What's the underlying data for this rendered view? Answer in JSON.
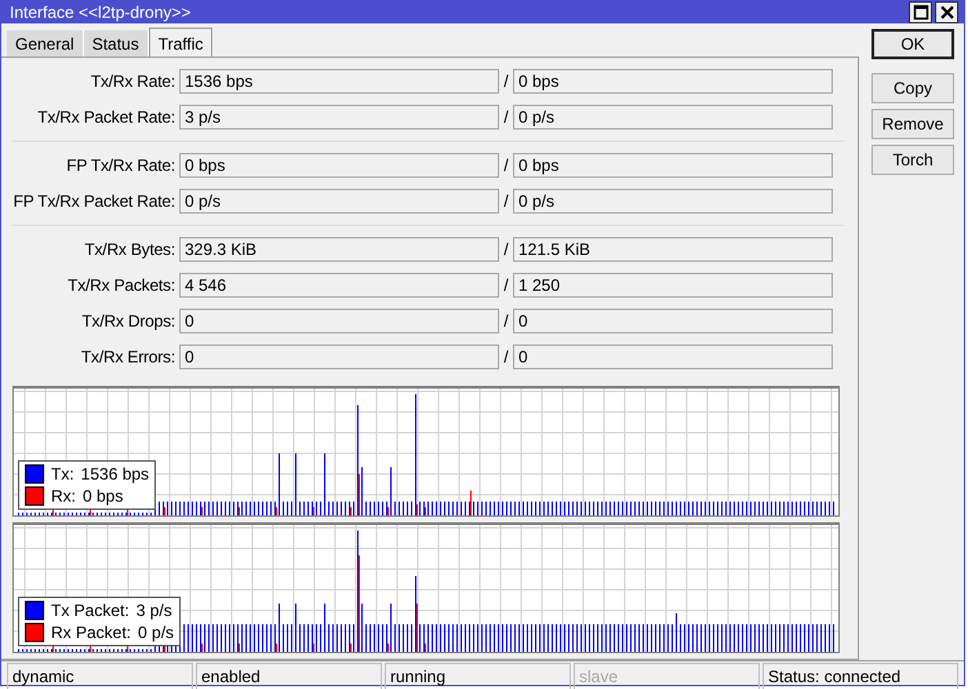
{
  "window": {
    "title": "Interface <<l2tp-drony>>"
  },
  "tabs": [
    {
      "label": "General",
      "selected": false
    },
    {
      "label": "Status",
      "selected": false
    },
    {
      "label": "Traffic",
      "selected": true
    }
  ],
  "groups": [
    {
      "rows": [
        {
          "label": "Tx/Rx Rate:",
          "tx": "1536 bps",
          "sep": "/",
          "rx": "0 bps"
        },
        {
          "label": "Tx/Rx Packet Rate:",
          "tx": "3 p/s",
          "sep": "/",
          "rx": "0 p/s"
        }
      ]
    },
    {
      "rows": [
        {
          "label": "FP Tx/Rx Rate:",
          "tx": "0 bps",
          "sep": "/",
          "rx": "0 bps"
        },
        {
          "label": "FP Tx/Rx Packet Rate:",
          "tx": "0 p/s",
          "sep": "/",
          "rx": "0 p/s"
        }
      ]
    },
    {
      "rows": [
        {
          "label": "Tx/Rx Bytes:",
          "tx": "329.3 KiB",
          "sep": "/",
          "rx": "121.5 KiB"
        },
        {
          "label": "Tx/Rx Packets:",
          "tx": "4 546",
          "sep": "/",
          "rx": "1 250"
        },
        {
          "label": "Tx/Rx Drops:",
          "tx": "0",
          "sep": "/",
          "rx": "0"
        },
        {
          "label": "Tx/Rx Errors:",
          "tx": "0",
          "sep": "/",
          "rx": "0"
        }
      ]
    }
  ],
  "graphs": [
    {
      "legend": [
        {
          "label": "Tx:",
          "value": "1536 bps",
          "color": "#0000ff"
        },
        {
          "label": "Rx:",
          "value": "0 bps",
          "color": "#ff0000"
        }
      ]
    },
    {
      "legend": [
        {
          "label": "Tx Packet:",
          "value": "3 p/s",
          "color": "#0000ff"
        },
        {
          "label": "Rx Packet:",
          "value": "0 p/s",
          "color": "#ff0000"
        }
      ]
    }
  ],
  "buttons": [
    "OK",
    "Copy",
    "Remove",
    "Torch"
  ],
  "status_bar": [
    {
      "text": "dynamic",
      "disabled": false
    },
    {
      "text": "enabled",
      "disabled": false
    },
    {
      "text": "running",
      "disabled": false
    },
    {
      "text": "slave",
      "disabled": true
    },
    {
      "text": "Status: connected",
      "disabled": false
    }
  ]
}
